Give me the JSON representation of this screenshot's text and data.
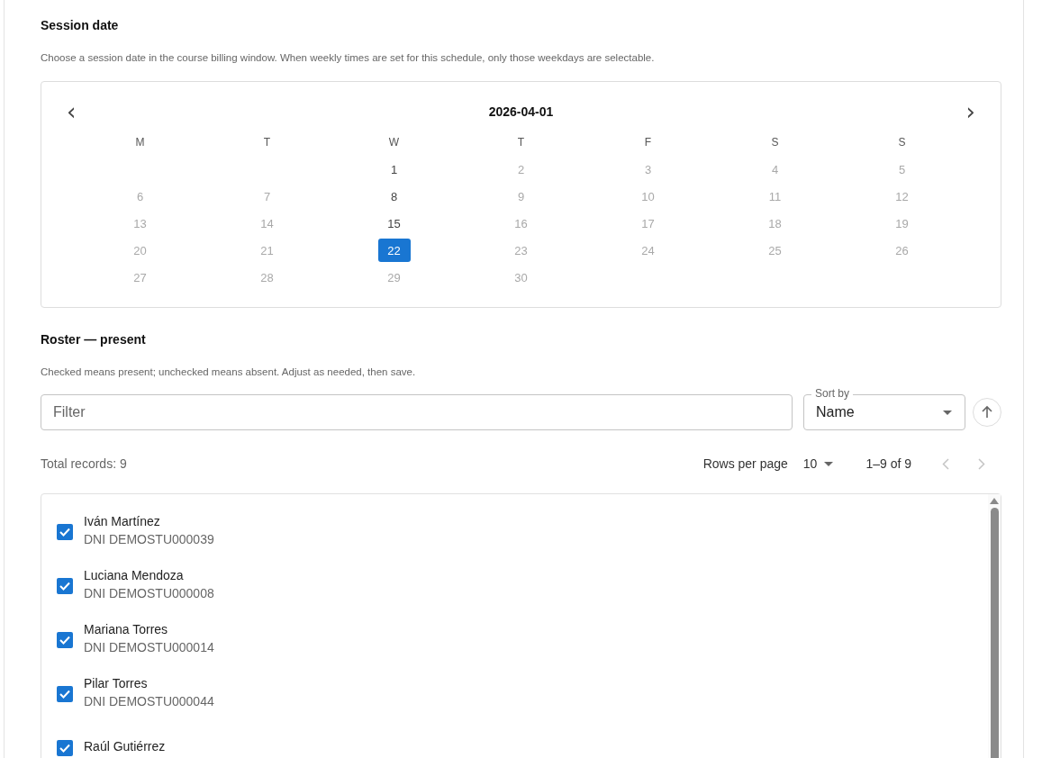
{
  "session": {
    "title": "Session date",
    "description": "Choose a session date in the course billing window. When weekly times are set for this schedule, only those weekdays are selectable.",
    "calendar": {
      "prev": "‹",
      "month": "2026-04-01",
      "next": "›",
      "weekdays": [
        "M",
        "T",
        "W",
        "T",
        "F",
        "S",
        "S"
      ],
      "weeks": [
        [
          {
            "kind": "blank"
          },
          {
            "kind": "blank"
          },
          {
            "kind": "day",
            "label": "1",
            "enabled": true,
            "selected": false
          },
          {
            "kind": "day",
            "label": "2",
            "enabled": false,
            "selected": false
          },
          {
            "kind": "day",
            "label": "3",
            "enabled": false,
            "selected": false
          },
          {
            "kind": "day",
            "label": "4",
            "enabled": false,
            "selected": false
          },
          {
            "kind": "day",
            "label": "5",
            "enabled": false,
            "selected": false
          }
        ],
        [
          {
            "kind": "day",
            "label": "6",
            "enabled": false,
            "selected": false
          },
          {
            "kind": "day",
            "label": "7",
            "enabled": false,
            "selected": false
          },
          {
            "kind": "day",
            "label": "8",
            "enabled": true,
            "selected": false
          },
          {
            "kind": "day",
            "label": "9",
            "enabled": false,
            "selected": false
          },
          {
            "kind": "day",
            "label": "10",
            "enabled": false,
            "selected": false
          },
          {
            "kind": "day",
            "label": "11",
            "enabled": false,
            "selected": false
          },
          {
            "kind": "day",
            "label": "12",
            "enabled": false,
            "selected": false
          }
        ],
        [
          {
            "kind": "day",
            "label": "13",
            "enabled": false,
            "selected": false
          },
          {
            "kind": "day",
            "label": "14",
            "enabled": false,
            "selected": false
          },
          {
            "kind": "day",
            "label": "15",
            "enabled": true,
            "selected": false
          },
          {
            "kind": "day",
            "label": "16",
            "enabled": false,
            "selected": false
          },
          {
            "kind": "day",
            "label": "17",
            "enabled": false,
            "selected": false
          },
          {
            "kind": "day",
            "label": "18",
            "enabled": false,
            "selected": false
          },
          {
            "kind": "day",
            "label": "19",
            "enabled": false,
            "selected": false
          }
        ],
        [
          {
            "kind": "day",
            "label": "20",
            "enabled": false,
            "selected": false
          },
          {
            "kind": "day",
            "label": "21",
            "enabled": false,
            "selected": false
          },
          {
            "kind": "day",
            "label": "22",
            "enabled": true,
            "selected": true
          },
          {
            "kind": "day",
            "label": "23",
            "enabled": false,
            "selected": false
          },
          {
            "kind": "day",
            "label": "24",
            "enabled": false,
            "selected": false
          },
          {
            "kind": "day",
            "label": "25",
            "enabled": false,
            "selected": false
          },
          {
            "kind": "day",
            "label": "26",
            "enabled": false,
            "selected": false
          }
        ],
        [
          {
            "kind": "day",
            "label": "27",
            "enabled": false,
            "selected": false
          },
          {
            "kind": "day",
            "label": "28",
            "enabled": false,
            "selected": false
          },
          {
            "kind": "day",
            "label": "29",
            "enabled": false,
            "selected": false
          },
          {
            "kind": "day",
            "label": "30",
            "enabled": false,
            "selected": false
          },
          {
            "kind": "blank"
          },
          {
            "kind": "blank"
          },
          {
            "kind": "blank"
          }
        ]
      ]
    }
  },
  "roster": {
    "title": "Roster — present",
    "description": "Checked means present; unchecked means absent. Adjust as needed, then save.",
    "filter": {
      "placeholder": "Filter"
    },
    "sort": {
      "label": "Sort by",
      "value": "Name"
    },
    "total": "Total records: 9",
    "pagination": {
      "rows_label": "Rows per page",
      "rows_value": "10",
      "range": "1–9 of 9"
    },
    "students": [
      {
        "name": "Iván Martínez",
        "id": "DNI DEMOSTU000039",
        "checked": true
      },
      {
        "name": "Luciana Mendoza",
        "id": "DNI DEMOSTU000008",
        "checked": true
      },
      {
        "name": "Mariana Torres",
        "id": "DNI DEMOSTU000014",
        "checked": true
      },
      {
        "name": "Pilar Torres",
        "id": "DNI DEMOSTU000044",
        "checked": true
      },
      {
        "name": "Raúl Gutiérrez",
        "checked": true
      }
    ]
  }
}
